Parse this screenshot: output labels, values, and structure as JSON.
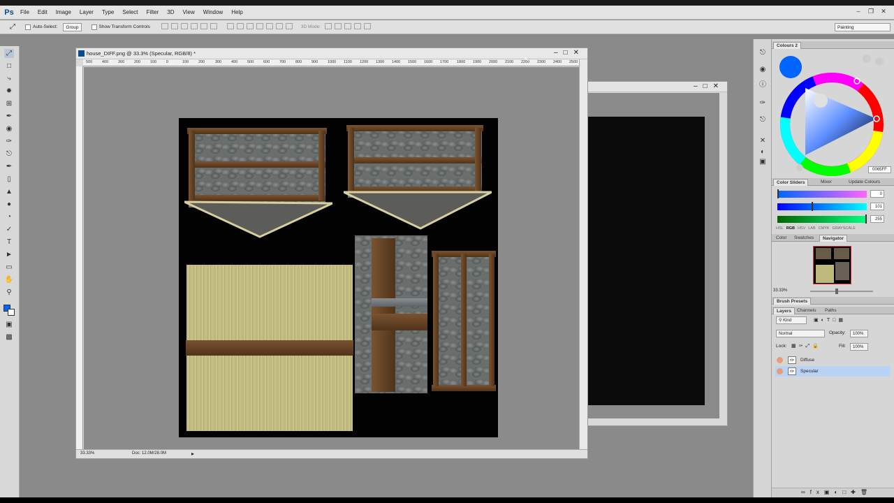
{
  "app": {
    "logo": "Ps",
    "menu": [
      "File",
      "Edit",
      "Image",
      "Layer",
      "Type",
      "Select",
      "Filter",
      "3D",
      "View",
      "Window",
      "Help"
    ]
  },
  "options": {
    "auto_select": "Auto-Select:",
    "group": "Group",
    "show_transform": "Show Transform Controls",
    "mode_3d": "3D Mode:",
    "workspace": "Painting"
  },
  "document": {
    "title": "house_DIFF.png @ 33.3% (Specular, RGB/8) *",
    "zoom": "33.33%",
    "doc_size": "Doc: 12.0M/28.0M",
    "ruler_labels": [
      "500",
      "400",
      "300",
      "200",
      "100",
      "0",
      "100",
      "200",
      "300",
      "400",
      "500",
      "600",
      "700",
      "800",
      "900",
      "1000",
      "1100",
      "1200",
      "1300",
      "1400",
      "1500",
      "1600",
      "1700",
      "1800",
      "1900",
      "2000",
      "2100",
      "2200",
      "2300",
      "2400",
      "2500"
    ]
  },
  "colours_panel": {
    "title": "Colours 2",
    "hex": "0065FF",
    "tabs": [
      "Color Sliders",
      "Mixer",
      "Update Colours"
    ],
    "sliders": [
      {
        "value": "0",
        "gradient": "linear-gradient(90deg,#0065ff,#ff65ff)",
        "thumb_fraction": 0.0
      },
      {
        "value": "101",
        "gradient": "linear-gradient(90deg,#0000ff,#00ffff)",
        "thumb_fraction": 0.39
      },
      {
        "value": "255",
        "gradient": "linear-gradient(90deg,#006500,#00ff7f)",
        "thumb_fraction": 1.0
      }
    ],
    "models": [
      "HSL",
      "RGB",
      "HSV",
      "LAB",
      "CMYK",
      "GRAYSCALE"
    ]
  },
  "navigator": {
    "tabs": [
      "Color",
      "Swatches",
      "Navigator"
    ],
    "zoom": "33.33%"
  },
  "brush_presets": {
    "title": "Brush Presets"
  },
  "layers": {
    "tabs": [
      "Layers",
      "Channels",
      "Paths"
    ],
    "kind": "Kind",
    "blend": "Normal",
    "opacity_label": "Opacity:",
    "opacity": "100%",
    "lock_label": "Lock:",
    "fill_label": "Fill:",
    "fill": "100%",
    "items": [
      {
        "name": "Diffuse",
        "selected": false
      },
      {
        "name": "Specular",
        "selected": true
      }
    ]
  },
  "colors": {
    "accent": "#0065FF",
    "selection": "#b9d3f5"
  }
}
